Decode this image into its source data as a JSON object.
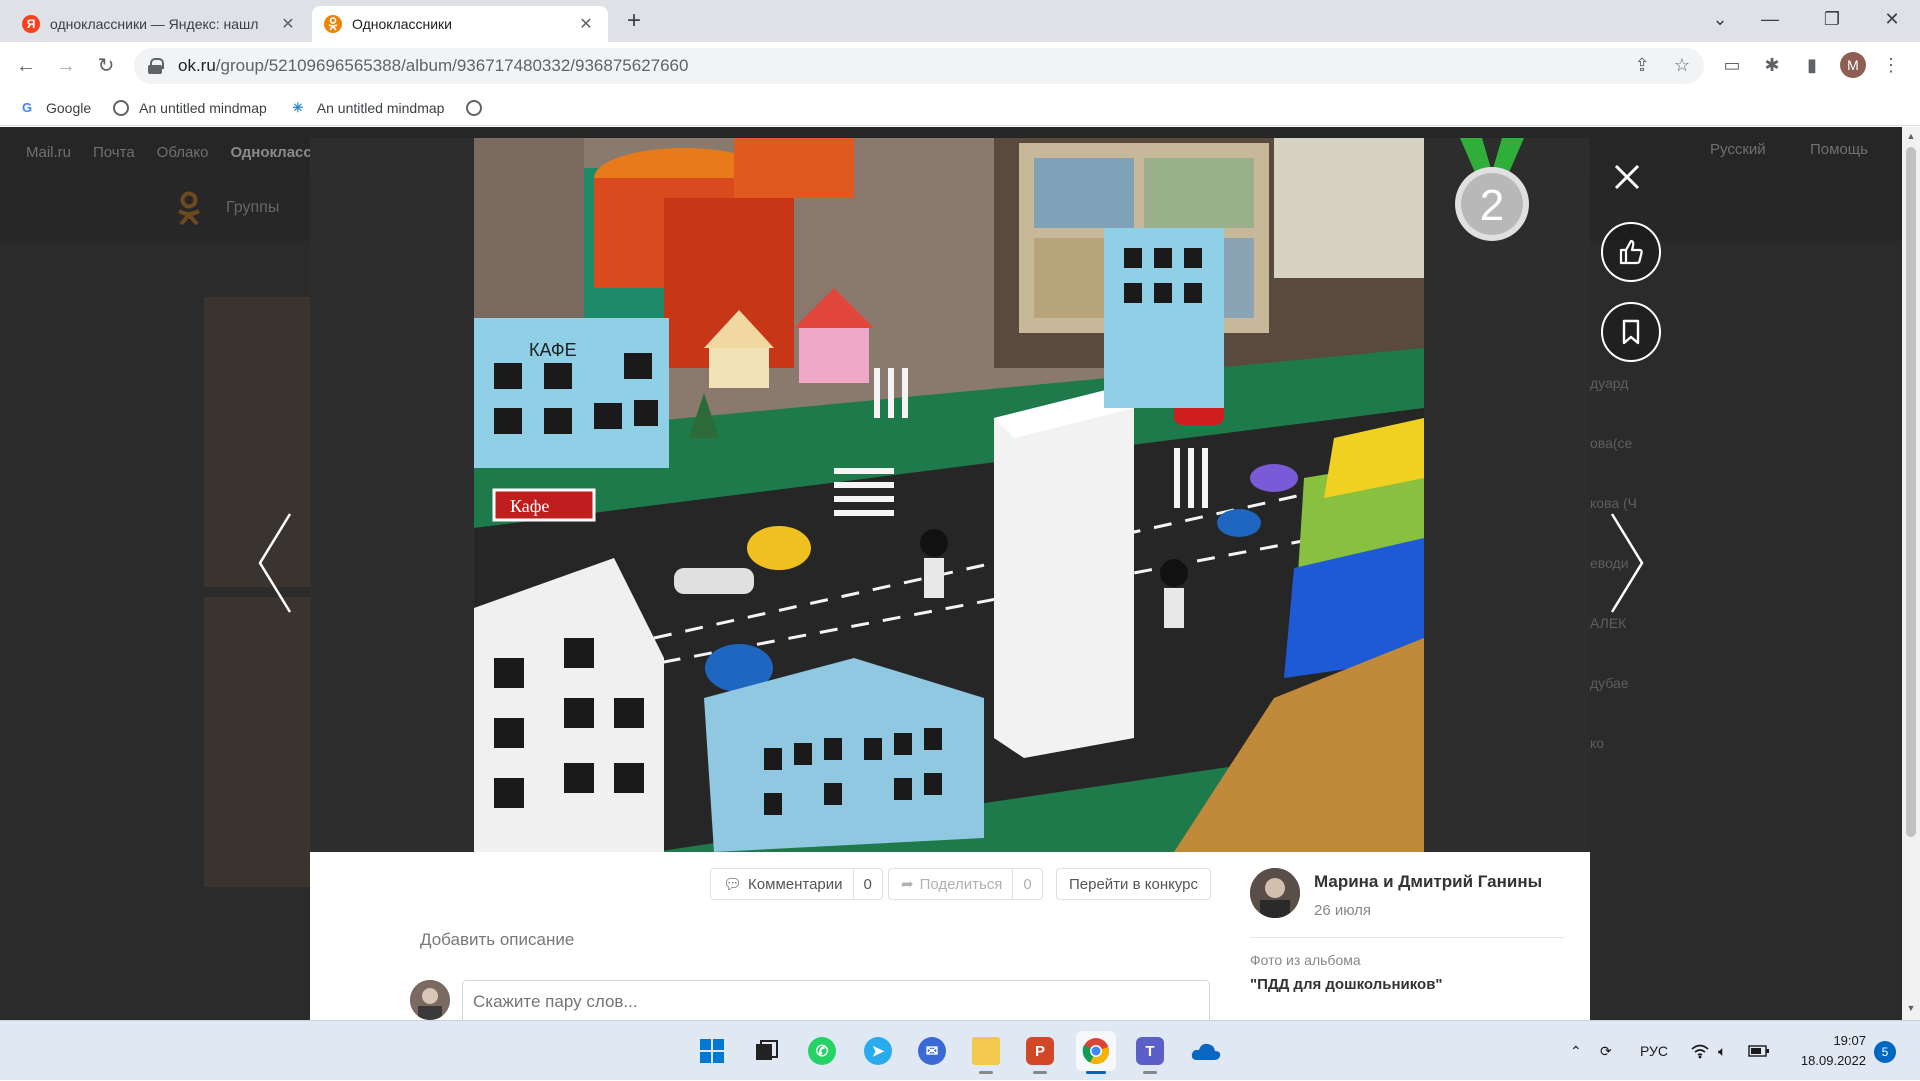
{
  "browser": {
    "tabs": [
      {
        "title": "одноклассники — Яндекс: нашл",
        "favicon": "yandex-icon",
        "color": "#fc3f1d"
      },
      {
        "title": "Одноклассники",
        "favicon": "ok-icon",
        "color": "#ee8208"
      }
    ],
    "url_host": "ok.ru",
    "url_path": "/group/52109696565388/album/936717480332/936875627660",
    "profile_initial": "M",
    "bookmarks": [
      {
        "label": "Google",
        "icon": "google-icon"
      },
      {
        "label": "An untitled mindmap",
        "icon": "globe-icon"
      },
      {
        "label": "An untitled mindmap",
        "icon": "mindmap-icon"
      },
      {
        "label": "",
        "icon": "globe-icon"
      }
    ]
  },
  "page_bg": {
    "nav": [
      "Mail.ru",
      "Почта",
      "Облако",
      "Однокласс"
    ],
    "lang": "Русский",
    "help": "Помощь",
    "groups_link": "Группы",
    "side_names": [
      "дуард",
      "ова(се",
      "кова (Ч",
      "еводи",
      "АЛЕК",
      "дубае",
      "ко"
    ]
  },
  "viewer": {
    "medal_number": "2",
    "actions": {
      "comments_label": "Комментарии",
      "comments_count": "0",
      "share_label": "Поделиться",
      "share_count": "0",
      "contest_label": "Перейти в конкурс"
    },
    "add_description": "Добавить описание",
    "comment_placeholder": "Скажите пару слов...",
    "author": {
      "name": "Марина и Дмитрий Ганины",
      "date": "26 июля"
    },
    "album_label": "Фото из альбома",
    "album_name": "\"ПДД для дошкольников\"",
    "photo_signs": {
      "cafe_building": "КАФЕ",
      "cafe_sign": "Кафе"
    }
  },
  "taskbar": {
    "apps": [
      {
        "name": "windows-start-icon",
        "color": "#0078d4"
      },
      {
        "name": "task-view-icon",
        "color": "#333333"
      },
      {
        "name": "whatsapp-icon",
        "color": "#25d366"
      },
      {
        "name": "telegram-icon",
        "color": "#2aabee"
      },
      {
        "name": "messenger-icon",
        "color": "#3b6ad6"
      },
      {
        "name": "file-explorer-icon",
        "color": "#f2c94c"
      },
      {
        "name": "powerpoint-icon",
        "color": "#d24726"
      },
      {
        "name": "chrome-icon",
        "color": "#1a73e8"
      },
      {
        "name": "teams-icon",
        "color": "#5b5fc7"
      },
      {
        "name": "onedrive-icon",
        "color": "#0a66c2"
      }
    ],
    "lang": "РУС",
    "time": "19:07",
    "date": "18.09.2022",
    "notifications": "5"
  }
}
